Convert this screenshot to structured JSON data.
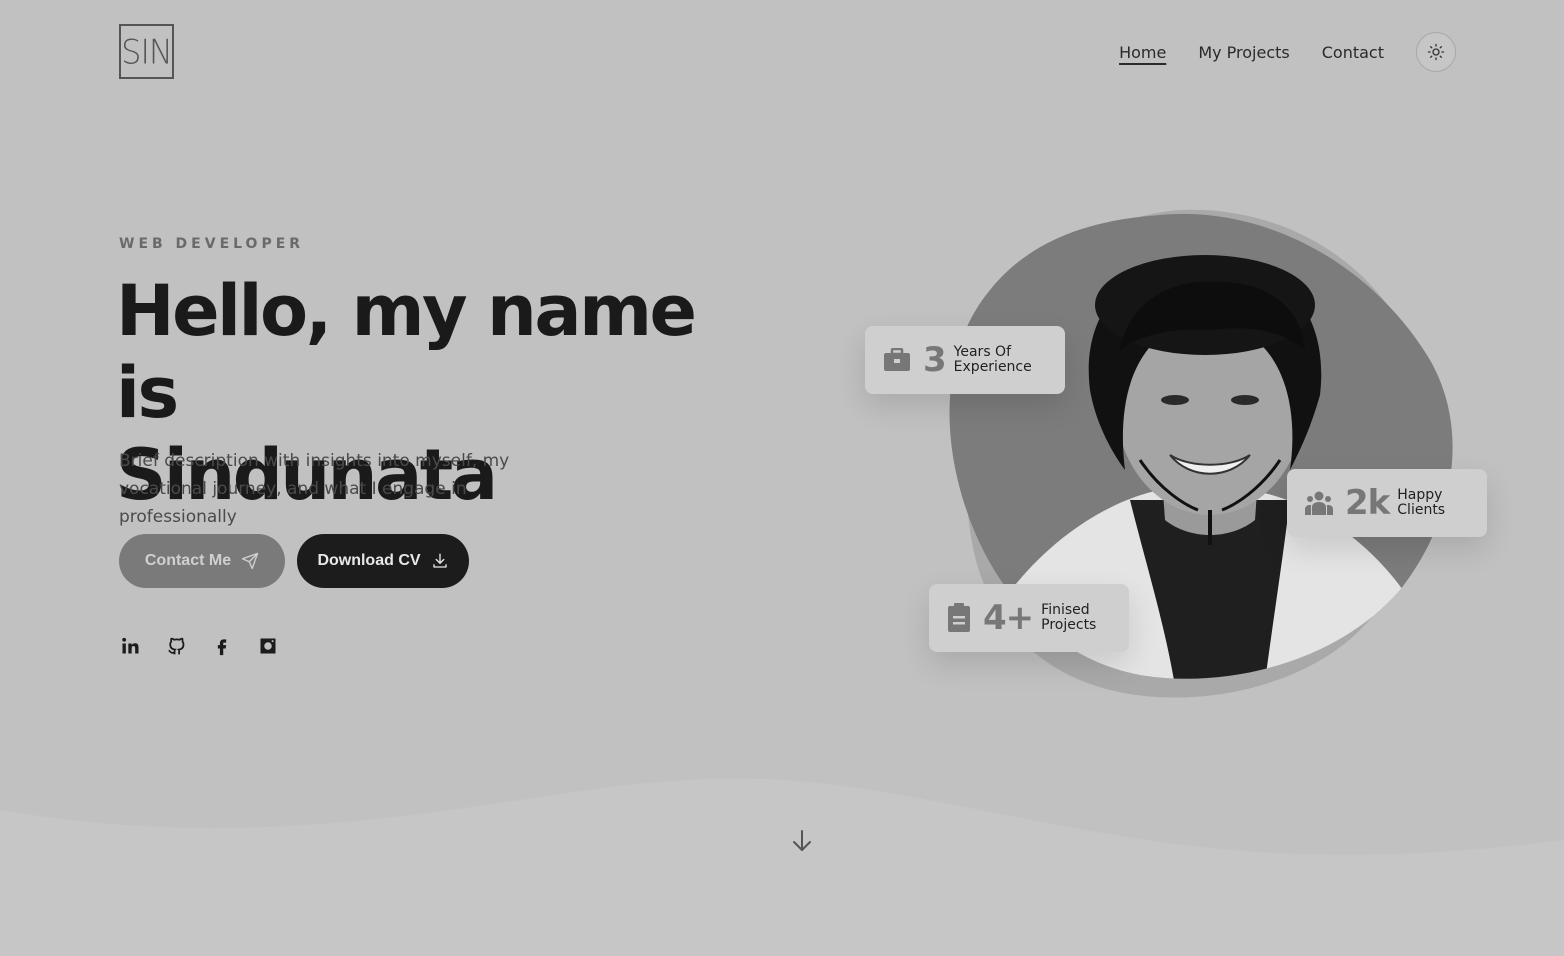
{
  "logo": {
    "text": "SIN"
  },
  "nav": {
    "items": [
      {
        "label": "Home",
        "active": true
      },
      {
        "label": "My Projects",
        "active": false
      },
      {
        "label": "Contact",
        "active": false
      }
    ],
    "theme_toggle_icon": "sun-icon"
  },
  "hero": {
    "eyebrow": "WEB DEVELOPER",
    "headline_line1": "Hello, my name is",
    "headline_line2": "Sindunata",
    "description": "Brief description with insights into myself, my vocational journey, and what I engage in professionally",
    "contact_button": "Contact Me",
    "contact_icon": "send-icon",
    "cv_button": "Download CV",
    "cv_icon": "download-icon"
  },
  "socials": [
    {
      "icon": "linkedin-icon"
    },
    {
      "icon": "github-icon"
    },
    {
      "icon": "facebook-icon"
    },
    {
      "icon": "instagram-icon"
    }
  ],
  "stats": {
    "experience": {
      "number": "3",
      "label": "Years Of Experience",
      "icon": "briefcase-icon"
    },
    "clients": {
      "number": "2k",
      "label": "Happy Clients",
      "icon": "people-icon"
    },
    "projects": {
      "number": "4+",
      "label": "Finised Projects",
      "icon": "clipboard-icon"
    }
  },
  "scroll_icon": "arrow-down-icon",
  "colors": {
    "background": "#c1c1c1",
    "dark": "#1c1c1c",
    "muted_button": "#7a7a7a"
  }
}
